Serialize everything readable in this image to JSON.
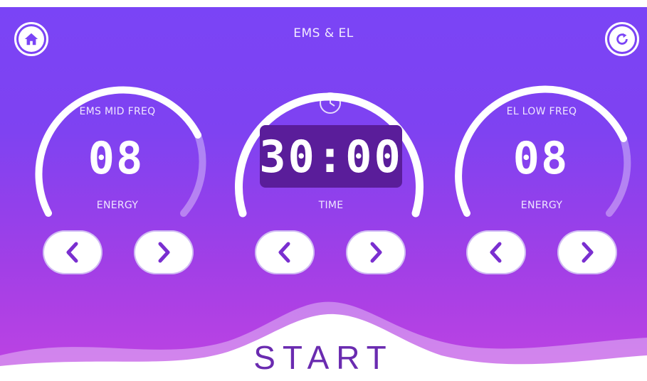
{
  "header": {
    "title": "EMS & EL",
    "home_icon": "home-icon",
    "refresh_icon": "refresh-icon"
  },
  "left_dial": {
    "label_top": "EMS MID FREQ",
    "value": "08",
    "label_bottom": "ENERGY"
  },
  "center_dial": {
    "icon": "clock-icon",
    "value": "30:00",
    "label_bottom": "TIME"
  },
  "right_dial": {
    "label_top": "EL LOW FREQ",
    "value": "08",
    "label_bottom": "ENERGY"
  },
  "controls": {
    "decrease_icon": "chevron-left-icon",
    "increase_icon": "chevron-right-icon"
  },
  "footer": {
    "start_label": "START"
  },
  "colors": {
    "background_top": "#7a44f6",
    "background_bottom": "#c043e2",
    "time_box": "#5a1d9a",
    "accent": "#7a2fd0"
  }
}
